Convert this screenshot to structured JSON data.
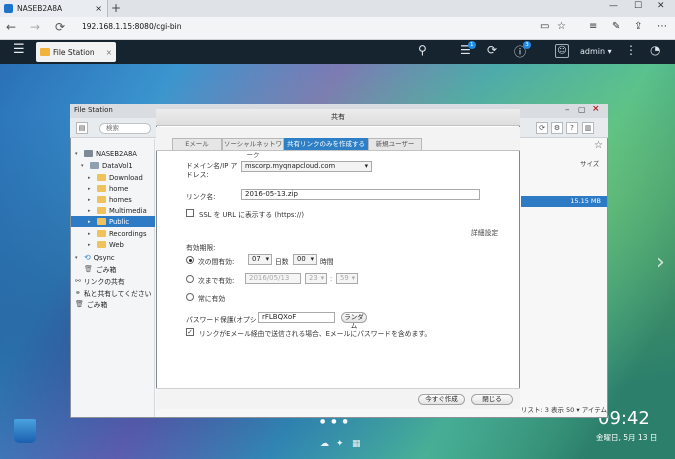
{
  "browser": {
    "tab_title": "NASEB2A8A",
    "tab_close": "×",
    "new_tab": "+",
    "url": "192.168.1.15:8080/cgi-bin",
    "back": "←",
    "forward": "→",
    "reload": "⟳",
    "win_min": "—",
    "win_max": "☐",
    "win_close": "✕"
  },
  "qnap_header": {
    "app_tab": "File Station",
    "app_tab_close": "×",
    "badges": {
      "tasks": "1",
      "info": "3"
    },
    "user": "admin ▾"
  },
  "file_station": {
    "title": "File Station",
    "search_placeholder": "検索",
    "tree": [
      {
        "label": "NASEB2A8A"
      },
      {
        "label": "DataVol1"
      },
      {
        "label": "Download"
      },
      {
        "label": "home"
      },
      {
        "label": "homes"
      },
      {
        "label": "Multimedia"
      },
      {
        "label": "Public"
      },
      {
        "label": "Recordings"
      },
      {
        "label": "Web"
      },
      {
        "label": "Qsync"
      },
      {
        "label": "ごみ箱"
      },
      {
        "label": "リンクの共有"
      },
      {
        "label": "私と共有してください"
      },
      {
        "label": "ごみ箱"
      }
    ],
    "column_size": "サイズ",
    "selected_row_size": "15.15 MB",
    "footer": "リスト: 3 表示 50 ▾ アイテム"
  },
  "dialog": {
    "title": "共有",
    "tabs": [
      "Eメール",
      "ソーシャルネットワーク",
      "共有リンクのみを作成する",
      "新規ユーザー"
    ],
    "active_tab": 2,
    "domain_label": "ドメイン名/IP アドレス:",
    "domain_value": "mscorp.myqnapcloud.com",
    "link_name_label": "リンク名:",
    "link_name_value": "2016-05-13.zip",
    "ssl_label": "SSL を URL に表示する (https://)",
    "advanced": "詳細設定",
    "validity_label": "有効期限:",
    "opt_period": "次の間有効:",
    "period_days": "07",
    "days_unit": "日数",
    "period_hours": "00",
    "hours_unit": "時間",
    "opt_until": "次まで有効:",
    "until_date": "2016/05/13",
    "until_hour": "23",
    "until_minute": "59",
    "time_sep": ":",
    "opt_always": "常に有効",
    "password_label": "パスワード保護(オプション):",
    "password_value": "rFLBQXoF",
    "random_button": "ランダム",
    "email_password_note": "リンクがEメール経由で送信される場合、Eメールにパスワードを含めます。",
    "create_button": "今すぐ作成",
    "close_button": "閉じる"
  },
  "desktop": {
    "clock": "09:42",
    "date": "金曜日, 5月 13 日"
  },
  "colors": {
    "accent": "#2f7fc6",
    "header": "#16242f"
  }
}
